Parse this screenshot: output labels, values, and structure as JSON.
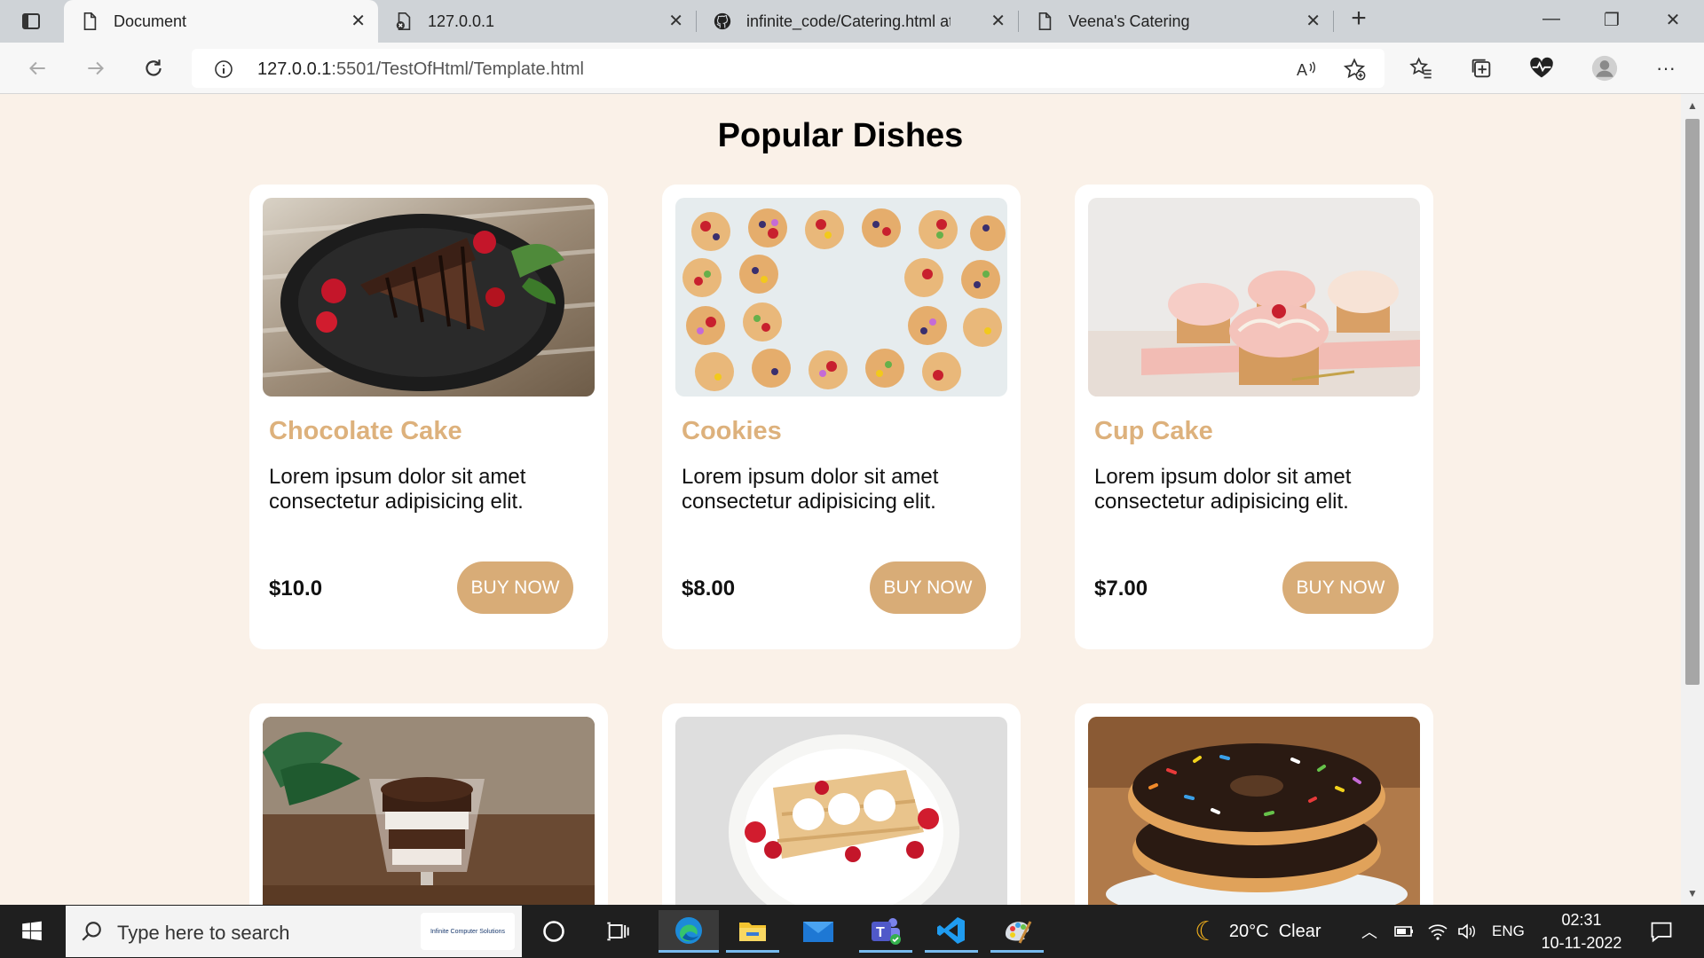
{
  "browser": {
    "tabs": [
      {
        "label": "Document",
        "active": true
      },
      {
        "label": "127.0.0.1",
        "active": false
      },
      {
        "label": "infinite_code/Catering.html at m",
        "active": false
      },
      {
        "label": "Veena's Catering",
        "active": false
      }
    ],
    "address": {
      "host": "127.0.0.1",
      "rest": ":5501/TestOfHtml/Template.html"
    }
  },
  "page": {
    "title": "Popular Dishes",
    "dishes": [
      {
        "name": "Chocolate Cake",
        "desc": "Lorem ipsum dolor sit amet consectetur adipisicing elit.",
        "price": "$10.0",
        "button": "BUY NOW"
      },
      {
        "name": "Cookies",
        "desc": "Lorem ipsum dolor sit amet consectetur adipisicing elit.",
        "price": "$8.00",
        "button": "BUY NOW"
      },
      {
        "name": "Cup Cake",
        "desc": "Lorem ipsum dolor sit amet consectetur adipisicing elit.",
        "price": "$7.00",
        "button": "BUY NOW"
      }
    ]
  },
  "taskbar": {
    "search_placeholder": "Type here to search",
    "search_logo_text": "Infinite Computer Solutions",
    "weather": "20°C  Clear",
    "language": "ENG",
    "time": "02:31",
    "date": "10-11-2022"
  },
  "colors": {
    "accent": "#d8ac77",
    "dish_name": "#ddb17c",
    "page_bg": "#faf1e8"
  }
}
